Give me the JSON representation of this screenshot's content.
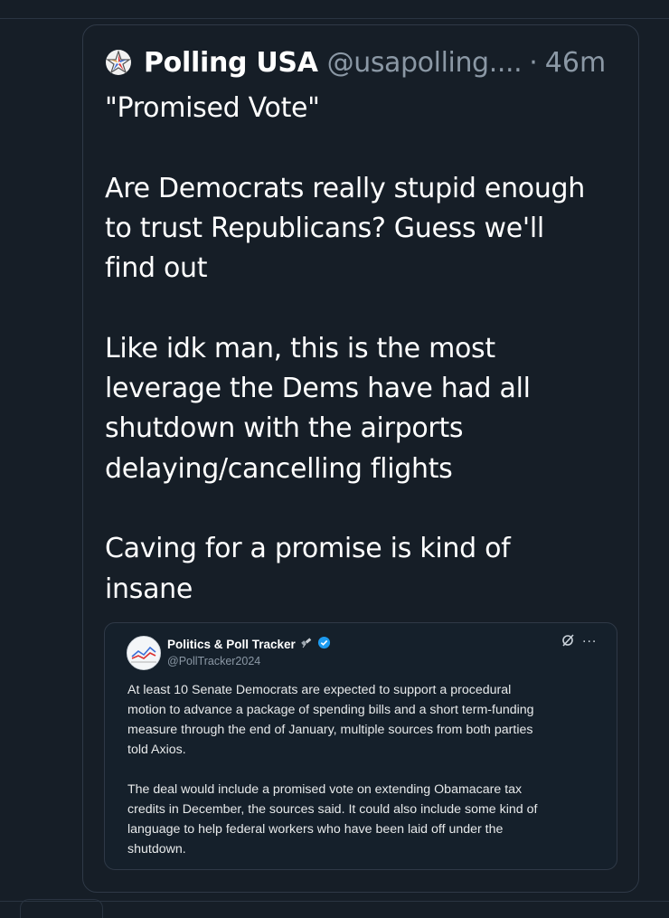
{
  "post": {
    "author": {
      "display_name": "Polling USA",
      "handle": "@usapolling....",
      "separator": "·",
      "time": "46m"
    },
    "body_paragraphs": [
      [
        "\"Promised Vote\""
      ],
      [
        "Are Democrats really stupid enough",
        "to trust Republicans? Guess we'll",
        "find out"
      ],
      [
        "Like idk man, this is the most",
        "leverage the Dems have had all",
        "shutdown with the airports",
        "delaying/cancelling flights"
      ],
      [
        "Caving for a promise is kind of",
        "insane"
      ]
    ]
  },
  "embedded_post": {
    "display_name": "Politics & Poll Tracker",
    "handle": "@PollTracker2024",
    "more_label": "···",
    "body_paragraphs": [
      [
        "At least 10 Senate Democrats are expected to support a procedural",
        "motion to advance a package of spending bills and a short term-funding",
        "measure through the end of January, multiple sources from both parties",
        "told Axios."
      ],
      [
        "The deal would include a promised vote on extending Obamacare tax",
        "credits in December, the sources said. It could also include some kind of",
        "language to help federal workers who have been laid off under the",
        "shutdown."
      ]
    ]
  },
  "colors": {
    "background": "#161e27",
    "muted_text": "#8b98a5",
    "verified_badge": "#1d9bf0"
  }
}
